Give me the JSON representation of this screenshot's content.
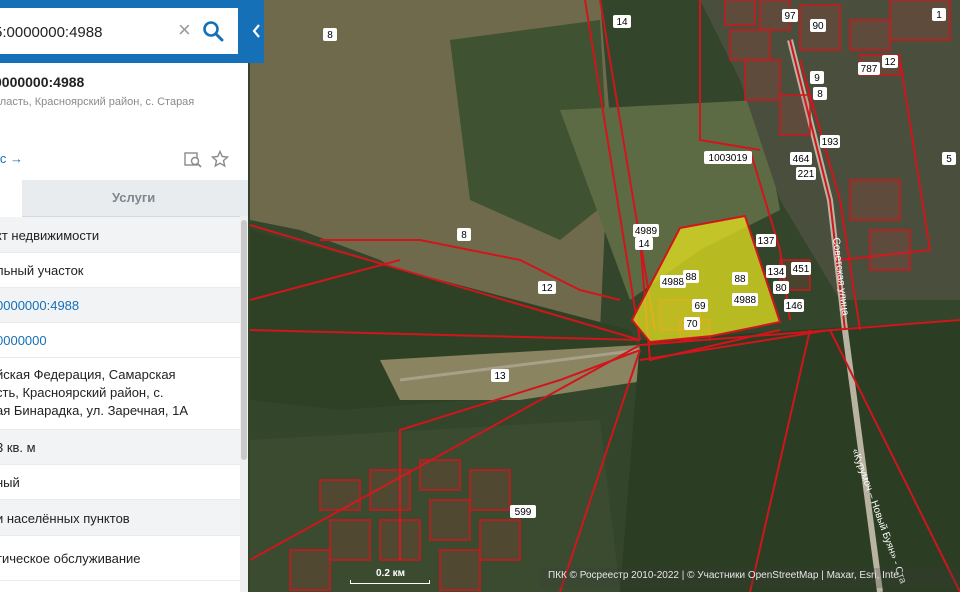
{
  "search": {
    "value": "5:0000000:4988",
    "clear": "×"
  },
  "object": {
    "title": "0000000:4988",
    "address": "бласть, Красноярский район, с. Старая",
    "more_link": "кс →"
  },
  "tabs": {
    "services": "Услуги"
  },
  "rows": [
    {
      "text": "кт недвижимости"
    },
    {
      "text": "льный участок"
    },
    {
      "text": "0000000:4988"
    },
    {
      "text": "0000000"
    },
    {
      "line1": "йская Федерация, Самарская",
      "line2": "сть, Красноярский район, с.",
      "line3": "ая Бинарадка, ул. Заречная, 1А"
    },
    {
      "text": "3 кв. м"
    },
    {
      "text": "ный"
    },
    {
      "text": "и населённых пунктов"
    },
    {
      "text": "тическое обслуживание"
    }
  ],
  "map": {
    "scale_label": "0.2 км",
    "attribution": "ПКК © Росреестр 2010-2022 | © Участники OpenStreetMap | Maxar, Esri, Inte",
    "labels": {
      "p8a": "8",
      "p14a": "14",
      "p1003019": "1003019",
      "p4989": "4989",
      "p14b": "14",
      "p8b": "8",
      "p12": "12",
      "p13": "13",
      "p599": "599",
      "p4988a": "4988",
      "p88a": "88",
      "p88b": "88",
      "p4988b": "4988",
      "p69": "69",
      "p70": "70",
      "p137": "137",
      "p134": "134",
      "p451": "451",
      "p80": "80",
      "p146": "146",
      "p90": "90",
      "p97": "97",
      "p9": "9",
      "p8c": "8",
      "p193": "193",
      "p464": "464",
      "p221": "221",
      "p787": "787",
      "p12b": "12",
      "p1": "1",
      "p5": "5"
    },
    "street1": "Советская улица",
    "street2": "«Курумоч – Новый Буян» - Ста"
  },
  "colors": {
    "accent": "#1570b8",
    "parcel_border": "#d0161c",
    "selected": "#e6e21f"
  }
}
